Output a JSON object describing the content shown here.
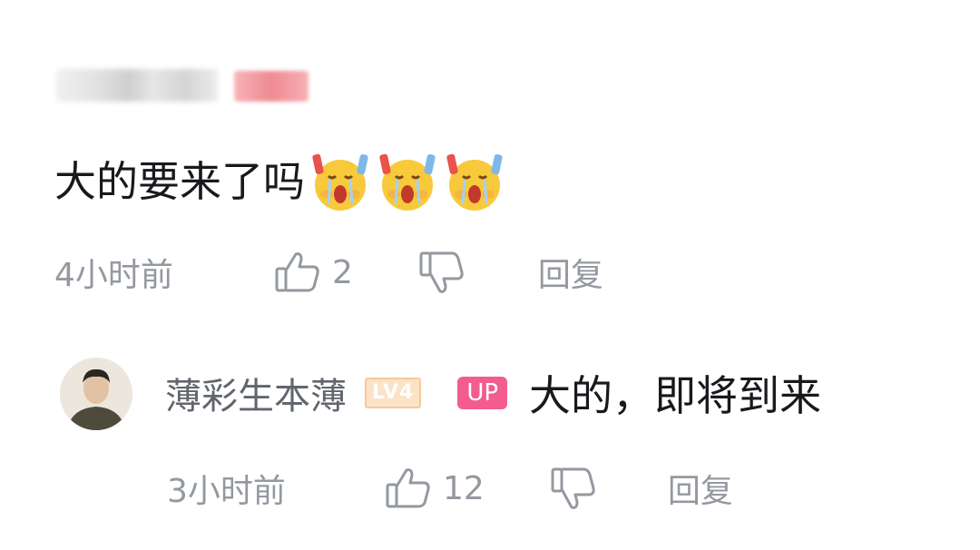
{
  "comment": {
    "text": "大的要来了吗",
    "emoji": [
      "crying-fan-emoji",
      "crying-fan-emoji",
      "crying-fan-emoji"
    ],
    "time": "4小时前",
    "likes": "2",
    "reply_label": "回复"
  },
  "reply": {
    "username": "薄彩生本薄",
    "level_badge": "LV4",
    "up_badge": "UP",
    "text": "大的，即将到来",
    "time": "3小时前",
    "likes": "12",
    "reply_label": "回复"
  },
  "icons": {
    "like": "thumbs-up-icon",
    "dislike": "thumbs-down-icon"
  },
  "colors": {
    "meta_gray": "#9499a0",
    "up_pink": "#f25d8e",
    "level_orange": "#f6c99a"
  }
}
